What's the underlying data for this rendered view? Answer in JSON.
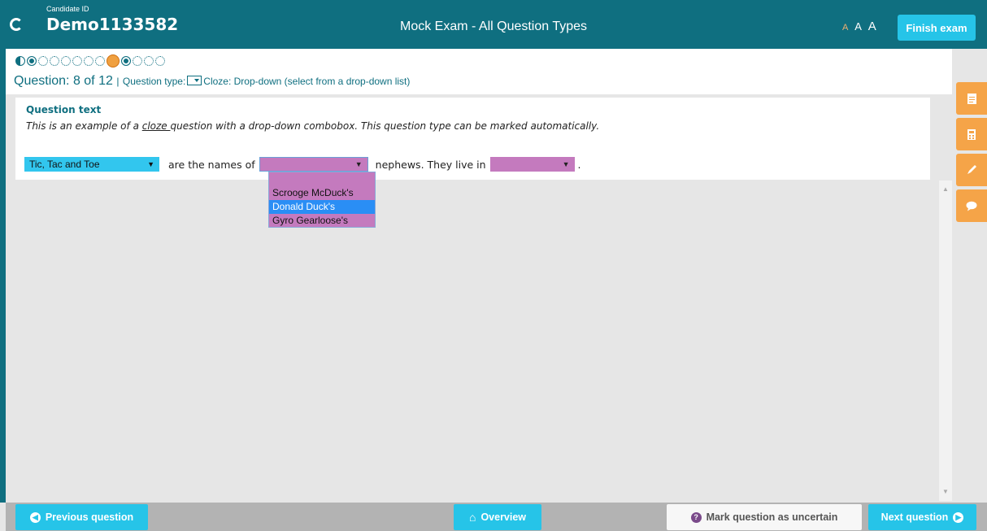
{
  "header": {
    "candidate_label": "Candidate ID",
    "candidate_id": "Demo1133582",
    "exam_title": "Mock Exam - All Question Types",
    "font_small": "A",
    "font_medium": "A",
    "font_large": "A",
    "finish_label": "Finish exam"
  },
  "progress": {
    "states": [
      "half",
      "done",
      "open",
      "open",
      "open",
      "open",
      "open",
      "open",
      "current",
      "done",
      "open",
      "open",
      "open"
    ]
  },
  "question_info": {
    "question_prefix": "Question:",
    "question_number": "8 of 12",
    "separator": "|",
    "type_prefix": "Question type:",
    "type_label": "Cloze: Drop-down (select from a drop-down list)"
  },
  "question": {
    "heading": "Question text",
    "text_before": "This is an example of a ",
    "text_underlined": "cloze ",
    "text_after": "question with a drop-down combobox. This question type can be marked automatically.",
    "select1_value": "Tic, Tac and Toe",
    "between1": "are the names of",
    "select2_value": "",
    "between2": "nephews. They live in",
    "select3_value": "",
    "end": "."
  },
  "dropdown": {
    "options": [
      "",
      "Scrooge McDuck's",
      "Donald Duck's",
      "Gyro Gearloose's"
    ],
    "highlighted": "Donald Duck's"
  },
  "tools": [
    "notes-icon",
    "calculator-icon",
    "pen-icon",
    "comment-icon"
  ],
  "footer": {
    "previous": "Previous question",
    "overview": "Overview",
    "uncertain": "Mark question as uncertain",
    "next": "Next question"
  },
  "colors": {
    "brand": "#0f6f80",
    "accent": "#26c4e8",
    "tool": "#f5a448",
    "select_fill": "#c47abe"
  }
}
